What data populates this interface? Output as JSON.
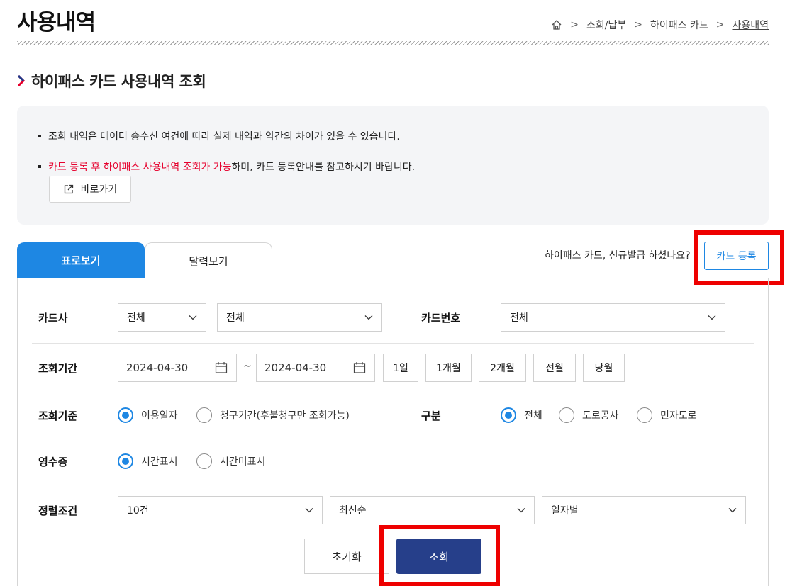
{
  "page": {
    "title": "사용내역"
  },
  "breadcrumb": {
    "items": [
      "조회/납부",
      "하이패스 카드",
      "사용내역"
    ]
  },
  "section": {
    "title": "하이패스 카드 사용내역 조회"
  },
  "notice": {
    "line1": "조회 내역은 데이터 송수신 여건에 따라 실제 내역과 약간의 차이가 있을 수 있습니다.",
    "line2_red": "카드 등록 후 하이패스 사용내역 조회가 가능",
    "line2_rest": "하며, 카드 등록안내를 참고하시기 바랍니다.",
    "goto_label": "바로가기"
  },
  "tabs": {
    "table_label": "표로보기",
    "calendar_label": "달력보기"
  },
  "register": {
    "question": "하이패스 카드, 신규발급 하셨나요?",
    "button_label": "카드 등록"
  },
  "form": {
    "card_company": {
      "label": "카드사",
      "select1": "전체",
      "select2": "전체"
    },
    "card_number": {
      "label": "카드번호",
      "value": "전체"
    },
    "period": {
      "label": "조회기간",
      "start": "2024-04-30",
      "separator": "~",
      "end": "2024-04-30",
      "buttons": [
        "1일",
        "1개월",
        "2개월",
        "전월",
        "당월"
      ]
    },
    "basis": {
      "label": "조회기준",
      "options": [
        "이용일자",
        "청구기간(후불청구만 조회가능)"
      ],
      "selected": "이용일자"
    },
    "category": {
      "label": "구분",
      "options": [
        "전체",
        "도로공사",
        "민자도로"
      ],
      "selected": "전체"
    },
    "receipt": {
      "label": "영수증",
      "options": [
        "시간표시",
        "시간미표시"
      ],
      "selected": "시간표시"
    },
    "sort": {
      "label": "정렬조건",
      "count": "10건",
      "order": "최신순",
      "group": "일자별"
    }
  },
  "actions": {
    "reset_label": "초기화",
    "search_label": "조회"
  },
  "colors": {
    "accent": "#1e87e3",
    "primary_button": "#263f8a",
    "highlight": "#e6002d",
    "annotation_box": "#ee0000"
  }
}
